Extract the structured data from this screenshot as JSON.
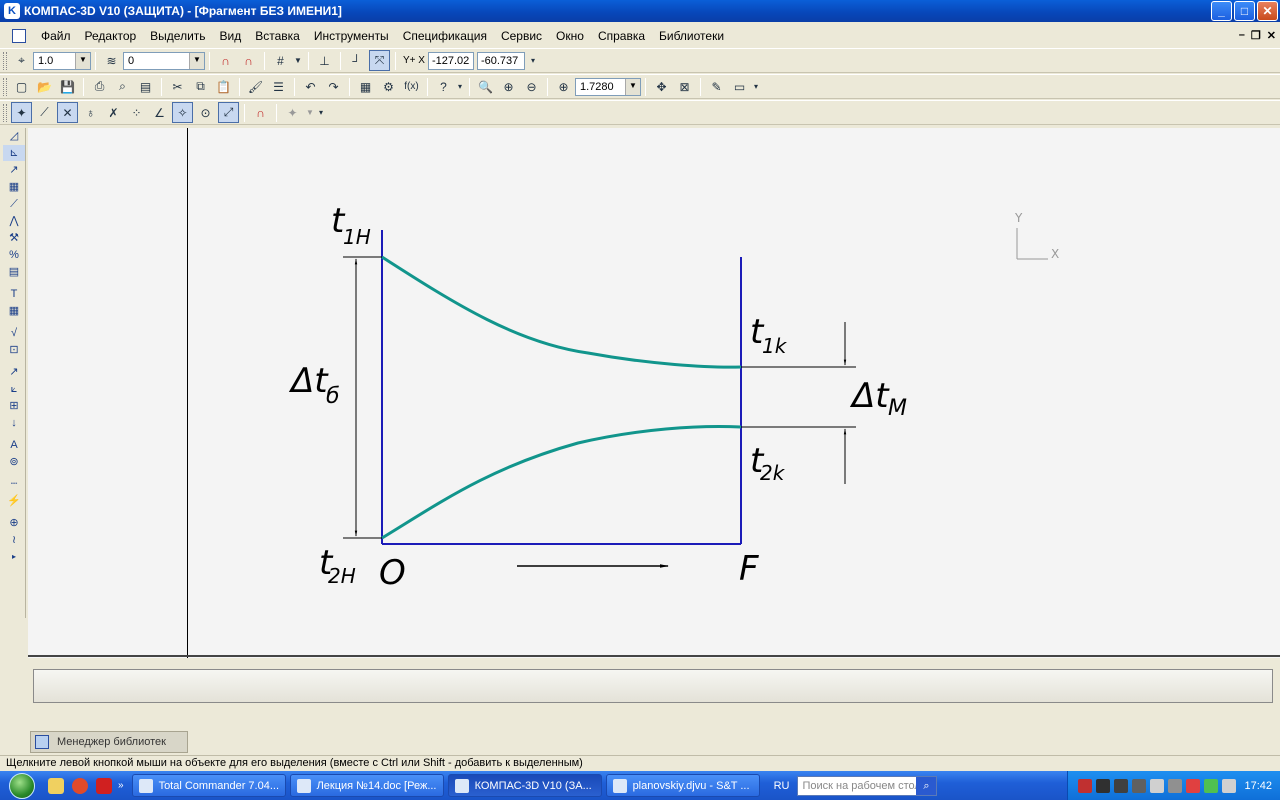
{
  "window": {
    "title": "КОМПАС-3D V10 (ЗАЩИТА) - [Фрагмент БЕЗ ИМЕНИ1]",
    "min": "_",
    "max": "□",
    "close": "✕"
  },
  "menu": [
    "Файл",
    "Редактор",
    "Выделить",
    "Вид",
    "Вставка",
    "Инструменты",
    "Спецификация",
    "Сервис",
    "Окно",
    "Справка",
    "Библиотеки"
  ],
  "toolbar1": {
    "scale_value": "1.0",
    "layer_value": "0",
    "coord_x": "-127.02",
    "coord_y": "-60.737",
    "coord_label": "Y+ X"
  },
  "toolbar2": {
    "zoom_value": "1.7280",
    "fx_label": "f(x)"
  },
  "drawing": {
    "label_t1h": "t",
    "sub_t1h": "1H",
    "label_t1k": "t",
    "sub_t1k": "1k",
    "label_t2k": "t",
    "sub_t2k": "2k",
    "label_t2h": "t",
    "sub_t2h": "2H",
    "label_delta_t_b": "Δt",
    "sub_delta_t_b": "б",
    "label_delta_t_m": "Δt",
    "sub_delta_t_m": "M",
    "label_origin": "O",
    "label_f": "F",
    "axis_y": "Y",
    "axis_x": "X",
    "colors": {
      "curve": "#11958c",
      "frame": "#1b1bb8",
      "ink": "#000000"
    }
  },
  "bottom": {
    "library_manager_tab": "Менеджер библиотек",
    "status_text": "Щелкните левой кнопкой мыши на объекте для его выделения (вместе с Ctrl или Shift - добавить к выделенным)"
  },
  "taskbar": {
    "tasks": [
      {
        "label": "Total Commander 7.04...",
        "active": false
      },
      {
        "label": "Лекция №14.doc [Реж...",
        "active": false
      },
      {
        "label": "КОМПАС-3D V10 (ЗА...",
        "active": true
      },
      {
        "label": "planovskiy.djvu - S&T ...",
        "active": false
      }
    ],
    "lang": "RU",
    "search_placeholder": "Поиск на рабочем столе",
    "clock": "17:42"
  }
}
